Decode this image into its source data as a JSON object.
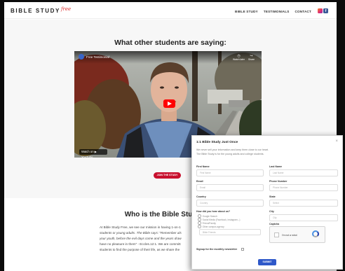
{
  "site": {
    "logo_main": "BIBLE STUDY",
    "logo_script": "free"
  },
  "nav": {
    "items": [
      "BIBLE STUDY",
      "TESTIMONIALS",
      "CONTACT"
    ]
  },
  "testimonials": {
    "heading": "What other students are saying:",
    "video": {
      "title": "Free Testimonial",
      "watch_on": "Watch on ▶ YouTube",
      "watch_later": "Watch later",
      "share": "Share"
    },
    "cta_label": "JOIN THE STUDY"
  },
  "about": {
    "heading": "Who is the Bible Study for?",
    "lines": [
      "At Bible Study Free, we see our mission in having 1-on-1",
      "students or young adults. The Bible says: \"Remember als",
      "your youth, before the evil days come and the years draw",
      "have no pleasure in them\" - Eccles.12:1. We are committ",
      "students to find the purpose of their life, as we share the"
    ]
  },
  "modal": {
    "title": "1:1 Bible Study Just Once",
    "close": "×",
    "desc_lines": [
      "We never sell your information and keep them close to our heart.",
      "The Bible Study is for the young adults and college students."
    ],
    "fields": {
      "first_name": {
        "label": "First Name",
        "placeholder": "First Name"
      },
      "last_name": {
        "label": "Last Name",
        "placeholder": "Last Name"
      },
      "email": {
        "label": "Email",
        "placeholder": "Email"
      },
      "phone": {
        "label": "Phone Number",
        "placeholder": "Phone Number"
      },
      "country": {
        "label": "Country",
        "placeholder": "Country"
      },
      "state": {
        "label": "State",
        "placeholder": "Select"
      },
      "city": {
        "label": "City",
        "placeholder": "City"
      }
    },
    "heard_label": "How did you hear about us?",
    "heard_options": [
      "Google Search",
      "Social Media (Facebook, Instagram...)",
      "Friend/Family",
      "Other campus agency"
    ],
    "heard_other_placeholder": "Bible Friends",
    "captcha_label": "Captcha",
    "captcha_text": "I'm not a robot",
    "newsletter_label": "Signup for the monthly newsletter",
    "submit_label": "SUBMIT"
  },
  "colors": {
    "accent_red": "#c8102e",
    "submit_blue": "#2e58c9",
    "youtube_red": "#ff0000",
    "facebook": "#3b5998"
  },
  "icons": [
    "instagram-icon",
    "facebook-icon",
    "youtube-play-icon",
    "close-icon",
    "recaptcha-icon"
  ]
}
